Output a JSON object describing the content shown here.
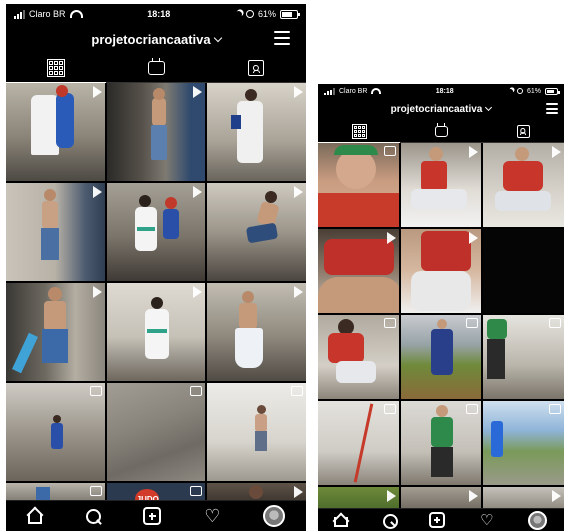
{
  "status_bar": {
    "carrier": "Claro BR",
    "time": "18:18",
    "battery": "61%"
  },
  "profile": {
    "username": "projetocriancaativa"
  },
  "icons": {
    "tab_grid": "grid-icon",
    "tab_igtv": "igtv-icon",
    "tab_tagged": "tagged-icon",
    "nav_home": "home-icon",
    "nav_search": "search-icon",
    "nav_add": "add-icon",
    "nav_activity": "heart-icon",
    "nav_profile": "avatar",
    "menu": "hamburger-icon",
    "dropdown": "chevron-down-icon"
  },
  "colors": {
    "background": "#000000",
    "text": "#ffffff"
  },
  "posts_left": [
    {
      "type": "video"
    },
    {
      "type": "video"
    },
    {
      "type": "video"
    },
    {
      "type": "video"
    },
    {
      "type": "video"
    },
    {
      "type": "video"
    },
    {
      "type": "video"
    },
    {
      "type": "video"
    },
    {
      "type": "video"
    },
    {
      "type": "igtv"
    },
    {
      "type": "igtv"
    },
    {
      "type": "igtv"
    },
    {
      "type": "igtv"
    },
    {
      "type": "igtv",
      "text": "JUDO"
    },
    {
      "type": "video"
    }
  ],
  "posts_right": [
    {
      "type": "igtv"
    },
    {
      "type": "video"
    },
    {
      "type": "video"
    },
    {
      "type": "video"
    },
    {
      "type": "video"
    },
    {
      "type": "none"
    },
    {
      "type": "igtv"
    },
    {
      "type": "igtv"
    },
    {
      "type": "igtv"
    },
    {
      "type": "igtv"
    },
    {
      "type": "igtv"
    },
    {
      "type": "igtv"
    },
    {
      "type": "video"
    },
    {
      "type": "video"
    },
    {
      "type": "video"
    }
  ]
}
